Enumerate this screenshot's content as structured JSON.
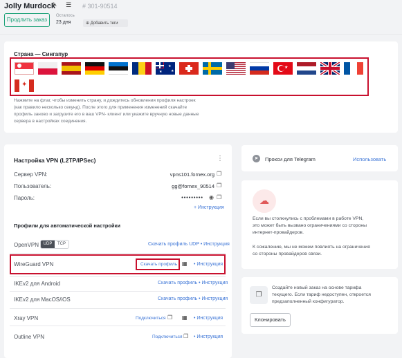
{
  "header": {
    "title": "Jolly Murdock",
    "order_id": "# 301-90514",
    "renew_button": "Продлить заказ",
    "remaining_label": "Осталось",
    "remaining_value": "23 дня",
    "add_tags": "Добавить теги"
  },
  "country": {
    "title": "Страна — Сингапур",
    "flags": [
      "singapore",
      "poland",
      "spain",
      "germany",
      "estonia",
      "romania",
      "australia",
      "switzerland",
      "sweden",
      "usa",
      "russia",
      "turkey",
      "netherlands",
      "uk",
      "france",
      "canada"
    ],
    "hint": [
      "Нажмите на флаг, чтобы изменить страну, и дождитесь обновления профиля настроек",
      "(как правило несколько секунд). После этого для применения изменений скачайте",
      "профиль заново и загрузите его в ваш VPN- клиент или укажите вручную новые данные",
      "сервера в настройках соединения."
    ]
  },
  "vpn": {
    "title": "Настройка VPN (L2TP/IPSec)",
    "server_label": "Сервер VPN:",
    "server_value": "vpns101.fornex.org",
    "user_label": "Пользователь:",
    "user_value": "gg@fornex_90514",
    "pass_label": "Пароль:",
    "pass_value": "●●●●●●●●●",
    "instructions": "+ Инструкция",
    "profiles_title": "Профили для автоматической настройки",
    "openvpn": "OpenVPN",
    "udp": "UDP",
    "tcp": "TCP",
    "openvpn_link": "Скачать профиль UDP • Инструкция",
    "wireguard": "WireGuard VPN",
    "wg_download": "Скачать профиль",
    "wg_instr": "• Инструкция",
    "ikev2_android": "IKEv2 для Android",
    "ikev2_android_link": "Скачать профиль • Инструкция",
    "ikev2_mac": "IKEv2 для MacOS/iOS",
    "ikev2_mac_link": "Скачать профиль • Инструкция",
    "xray": "Xray VPN",
    "connect": "Подключиться",
    "outline": "Outline VPN"
  },
  "telegram": {
    "title": "Прокси для Telegram",
    "action": "Использовать"
  },
  "notice": {
    "p1": [
      "Если вы столкнулись с проблемами в работе VPN,",
      "это может быть вызвано ограничениями со стороны",
      "интернет-провайдеров."
    ],
    "p2": [
      "К сожалению, мы не можем повлиять на ограничения",
      "со стороны провайдеров связи."
    ]
  },
  "clone": {
    "text": [
      "Создайте новый заказ на основе тарифа",
      "текущего. Если тариф недоступен, откроется",
      "предзаполненный конфигуратор."
    ],
    "button": "Клонировать"
  },
  "colors": {
    "accent": "#3b74d6",
    "highlight": "#c8102e",
    "renew": "#1fa37a"
  }
}
